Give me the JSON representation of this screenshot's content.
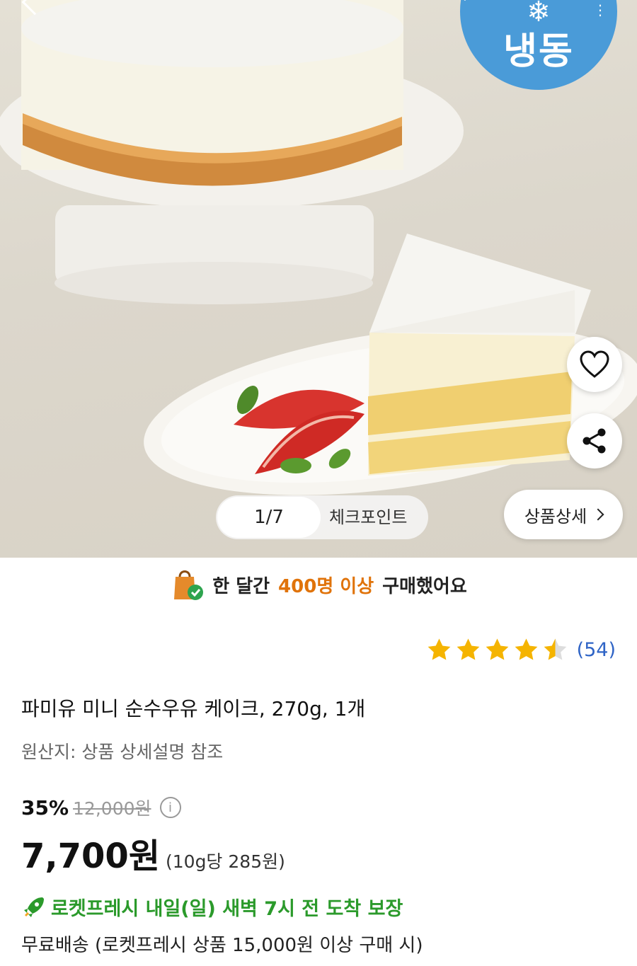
{
  "header": {
    "frozen_badge": "냉동",
    "icons": [
      "back-arrow-icon",
      "search-icon",
      "more-icon",
      "snowflake-icon"
    ]
  },
  "gallery": {
    "page_counter": "1/7",
    "checkpoint_label": "체크포인트",
    "detail_button": "상품상세",
    "actions": [
      "heart-icon",
      "share-icon"
    ]
  },
  "purchase_banner": {
    "prefix": "한 달간",
    "highlight": "400명 이상",
    "suffix": "구매했어요",
    "icon": "shopping-bag-check-icon",
    "highlight_color": "#e0730a"
  },
  "rating": {
    "stars": 4.5,
    "review_count": "(54)",
    "star_color": "#f5b400"
  },
  "product": {
    "title": "파미유 미니 순수우유 케이크, 270g, 1개",
    "origin": "원산지: 상품 상세설명 참조"
  },
  "price": {
    "discount": "35%",
    "original": "12,000원",
    "sale": "7,700원",
    "unit": "(10g당 285원)"
  },
  "delivery": {
    "text": "로켓프레시 내일(일) 새벽 7시 전 도착 보장",
    "shipping": "무료배송 (로켓프레시 상품 15,000원 이상 구매 시)",
    "color": "#2b9a2b"
  }
}
